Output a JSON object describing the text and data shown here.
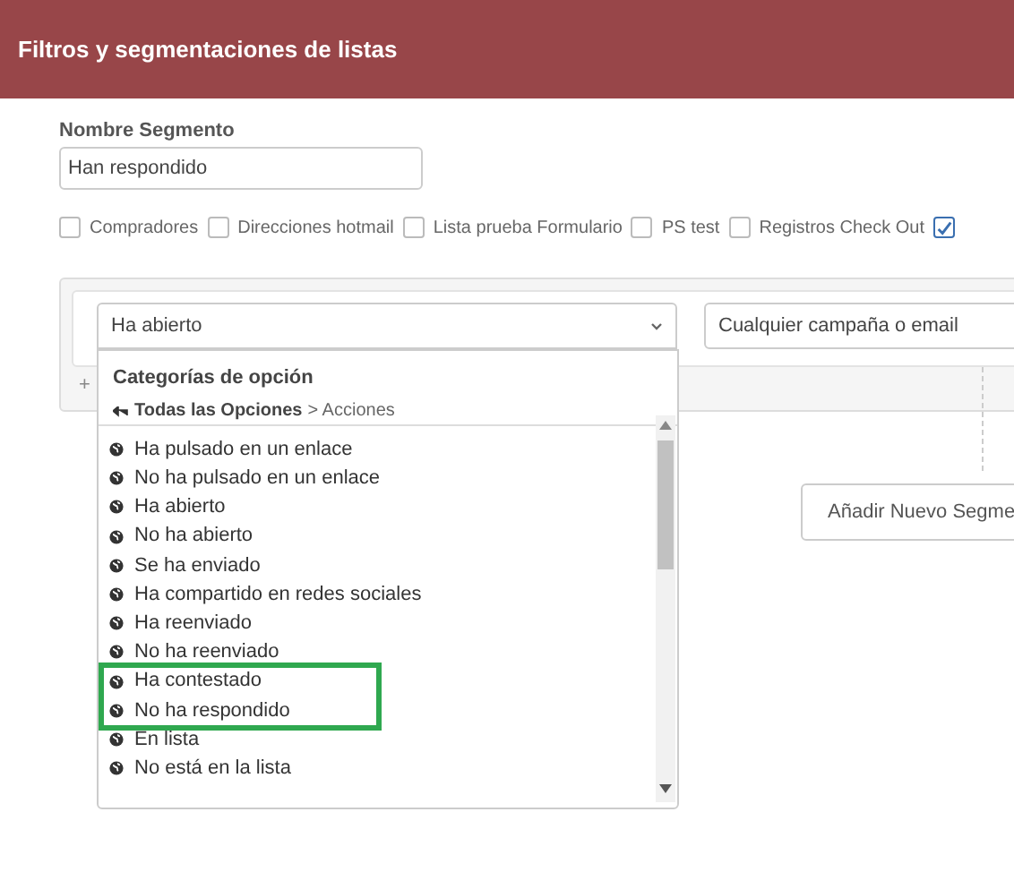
{
  "header": {
    "title": "Filtros y segmentaciones de listas"
  },
  "segment_name": {
    "label": "Nombre Segmento",
    "value": "Han respondido"
  },
  "lists": [
    {
      "label": "Compradores",
      "checked": false
    },
    {
      "label": "Direcciones hotmail",
      "checked": false
    },
    {
      "label": "Lista prueba Formulario",
      "checked": false
    },
    {
      "label": "PS test",
      "checked": false
    },
    {
      "label": "Registros Check Out",
      "checked": false
    },
    {
      "checked": true
    }
  ],
  "condition": {
    "field": {
      "value": "Ha abierto"
    },
    "campaign": {
      "value": "Cualquier campaña o email"
    },
    "add_icon": "+"
  },
  "dropdown": {
    "heading": "Categorías de opción",
    "breadcrumb_root": "Todas las Opciones",
    "breadcrumb_rest": "> Acciones",
    "options": [
      {
        "label": "Ha pulsado en un enlace",
        "highlighted": false
      },
      {
        "label": "No ha pulsado en un enlace",
        "highlighted": false
      },
      {
        "label": "Ha abierto",
        "highlighted": false
      },
      {
        "label": "No ha abierto",
        "highlighted": false
      },
      {
        "label": "Se ha enviado",
        "highlighted": false
      },
      {
        "label": "Ha compartido en redes sociales",
        "highlighted": false
      },
      {
        "label": "Ha reenviado",
        "highlighted": false
      },
      {
        "label": "No ha reenviado",
        "highlighted": false
      },
      {
        "label": "Ha contestado",
        "highlighted": true
      },
      {
        "label": "No ha respondido",
        "highlighted": true
      },
      {
        "label": "En lista",
        "highlighted": false
      },
      {
        "label": "No está en la lista",
        "highlighted": false
      }
    ]
  },
  "add_segment_button": "Añadir Nuevo Segme"
}
